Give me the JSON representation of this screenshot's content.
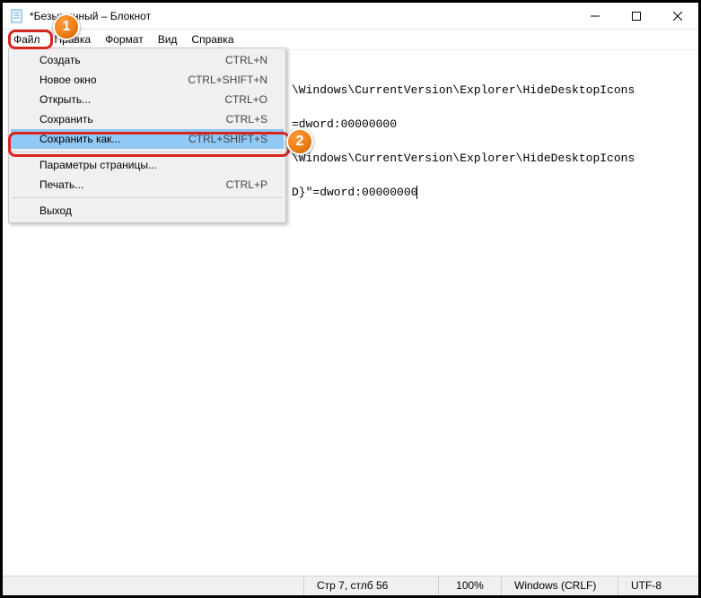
{
  "window": {
    "title": "*Безымянный – Блокнот"
  },
  "menubar": {
    "items": [
      "Файл",
      "Правка",
      "Формат",
      "Вид",
      "Справка"
    ]
  },
  "dropdown": {
    "items": [
      {
        "label": "Создать",
        "shortcut": "CTRL+N"
      },
      {
        "label": "Новое окно",
        "shortcut": "CTRL+SHIFT+N"
      },
      {
        "label": "Открыть...",
        "shortcut": "CTRL+O"
      },
      {
        "label": "Сохранить",
        "shortcut": "CTRL+S"
      },
      {
        "label": "Сохранить как...",
        "shortcut": "CTRL+SHIFT+S",
        "highlight": true
      },
      {
        "sep": true
      },
      {
        "label": "Параметры страницы...",
        "shortcut": ""
      },
      {
        "label": "Печать...",
        "shortcut": "CTRL+P"
      },
      {
        "sep": true
      },
      {
        "label": "Выход",
        "shortcut": ""
      }
    ]
  },
  "content": {
    "line1": "",
    "line2": "\\Windows\\CurrentVersion\\Explorer\\HideDesktopIcons",
    "line3": "",
    "line4": "=dword:00000000",
    "line5": "",
    "line6": "\\Windows\\CurrentVersion\\Explorer\\HideDesktopIcons",
    "line7": "",
    "line8": "D}\"=dword:00000000"
  },
  "status": {
    "pos": "Стр 7, стлб 56",
    "zoom": "100%",
    "eol": "Windows (CRLF)",
    "enc": "UTF-8"
  },
  "annotations": {
    "badge1": "1",
    "badge2": "2"
  }
}
